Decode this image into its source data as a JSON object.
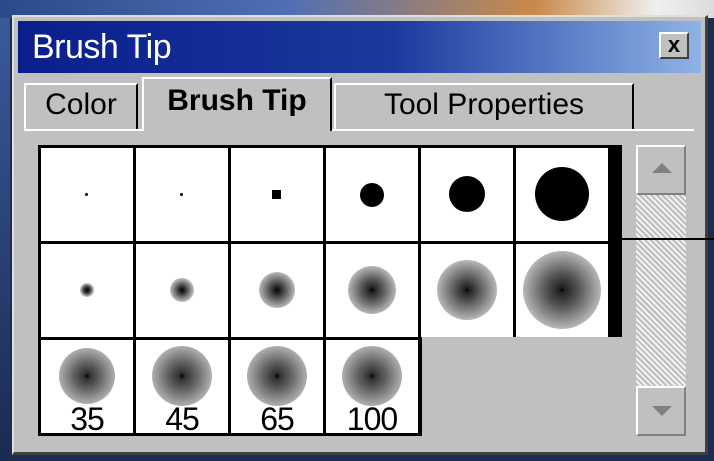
{
  "window": {
    "title": "Brush Tip",
    "close_glyph": "x"
  },
  "tabs": [
    {
      "label": "Color",
      "active": false
    },
    {
      "label": "Brush Tip",
      "active": true
    },
    {
      "label": "Tool Properties",
      "active": false
    }
  ],
  "brush_sizes": {
    "labels": [
      "35",
      "45",
      "65",
      "100"
    ]
  },
  "scrollbar": {
    "up_icon": "arrow-up-icon",
    "down_icon": "arrow-down-icon"
  }
}
